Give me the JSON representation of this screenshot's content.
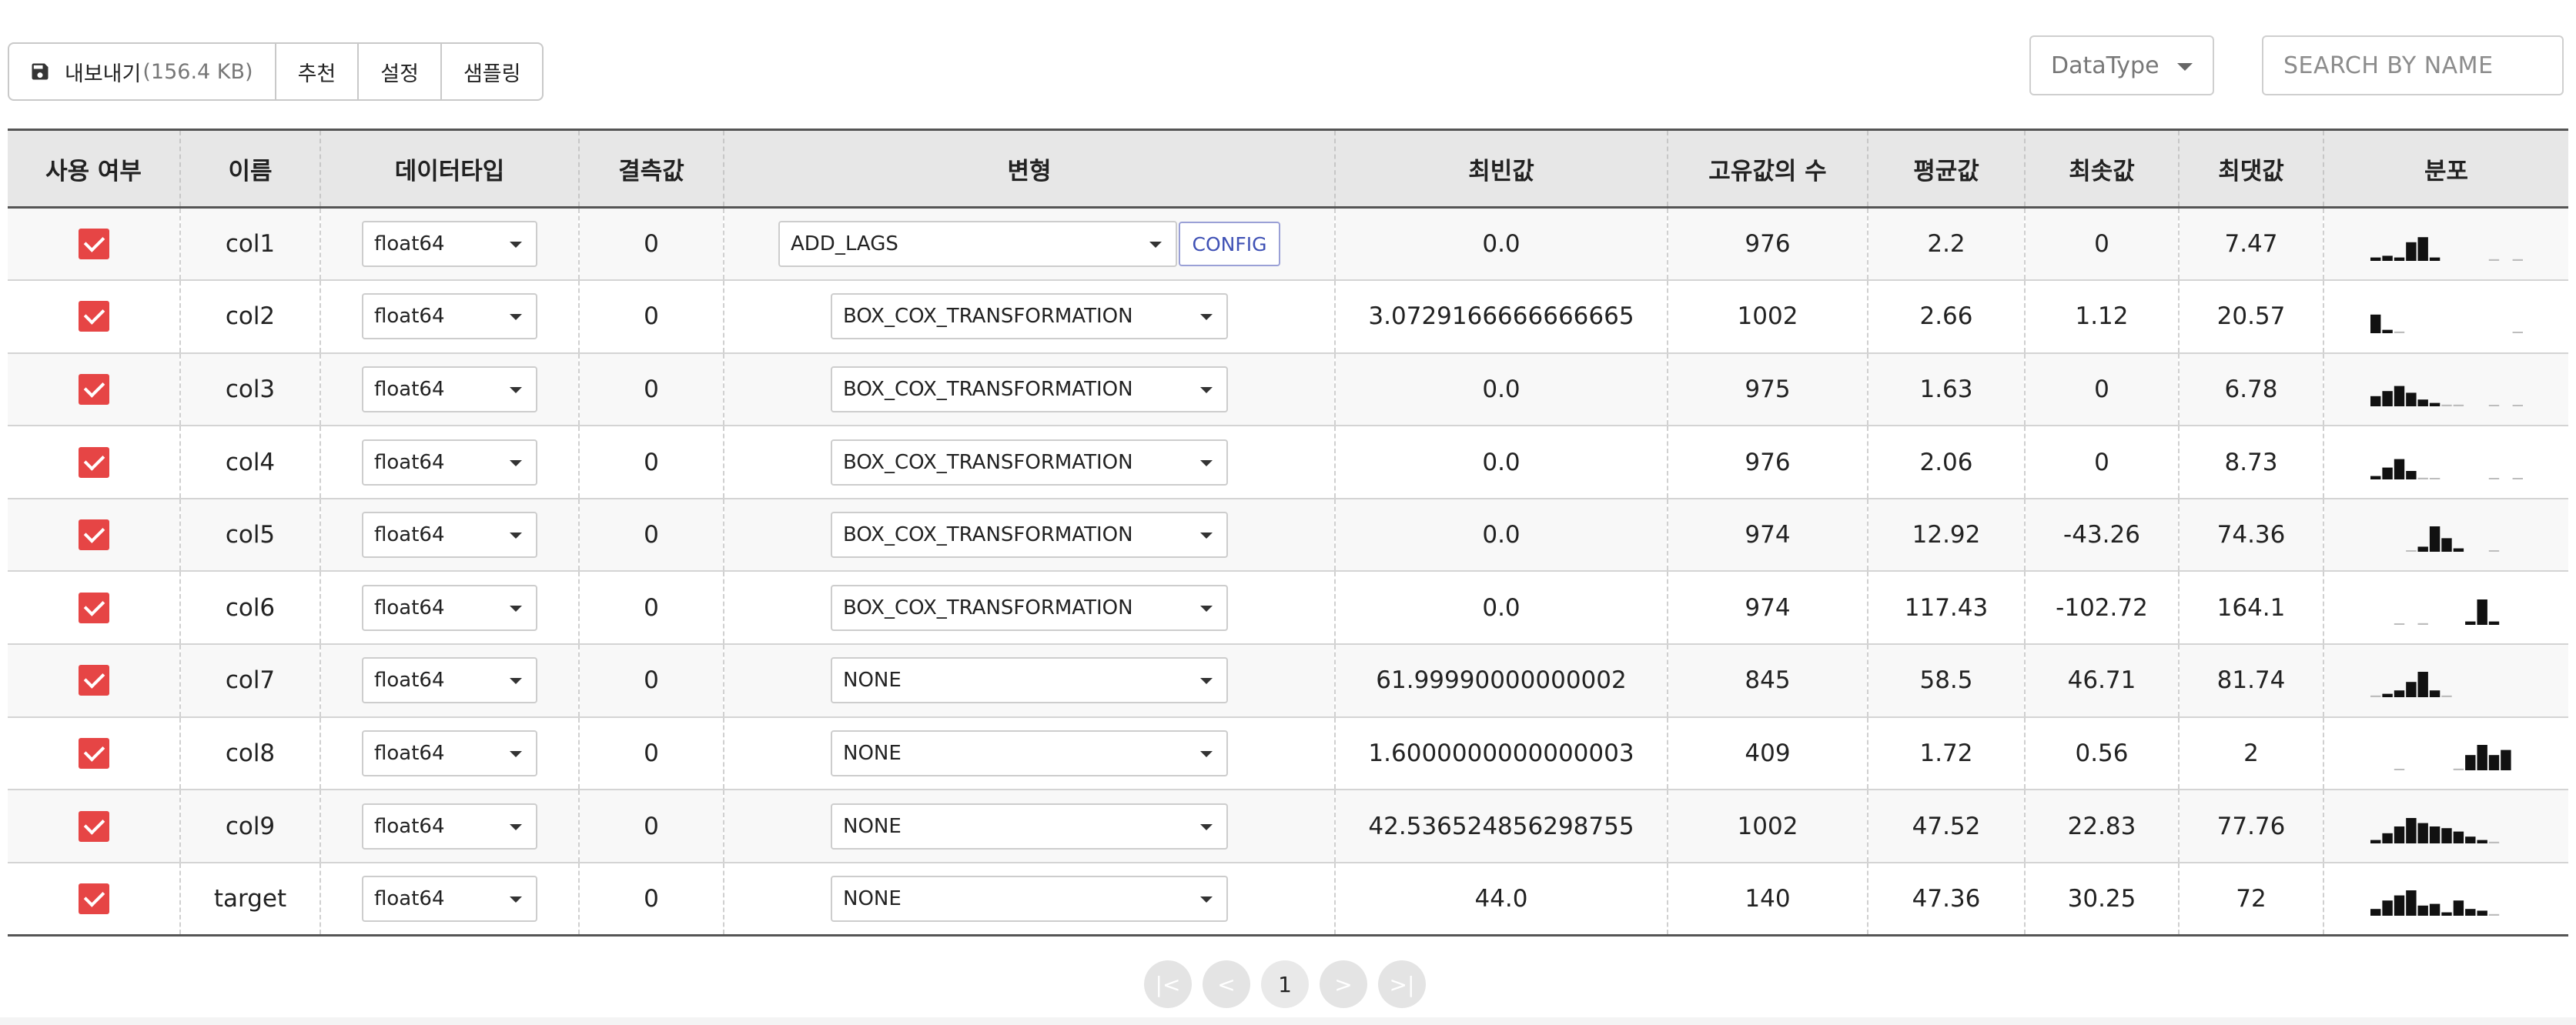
{
  "toolbar": {
    "export_label": "내보내기",
    "export_size": "(156.4 KB)",
    "recommend_label": "추천",
    "settings_label": "설정",
    "sampling_label": "샘플링",
    "datatype_filter": "DataType",
    "search_placeholder": "SEARCH BY NAME"
  },
  "table": {
    "headers": [
      "사용 여부",
      "이름",
      "데이터타입",
      "결측값",
      "변형",
      "최빈값",
      "고유값의 수",
      "평균값",
      "최솟값",
      "최댓값",
      "분포"
    ],
    "config_label": "CONFIG",
    "rows": [
      {
        "checked": true,
        "name": "col1",
        "dtype": "float64",
        "missing": "0",
        "transform": "ADD_LAGS",
        "has_config": true,
        "mode": "0.0",
        "unique": "976",
        "mean": "2.2",
        "min": "0",
        "max": "7.47",
        "hist": [
          0.1,
          0.15,
          0.1,
          0.55,
          0.7,
          0.1,
          0,
          0,
          0,
          0,
          0.05,
          0,
          0.05
        ]
      },
      {
        "checked": true,
        "name": "col2",
        "dtype": "float64",
        "missing": "0",
        "transform": "BOX_COX_TRANSFORMATION",
        "has_config": false,
        "mode": "3.0729166666666665",
        "unique": "1002",
        "mean": "2.66",
        "min": "1.12",
        "max": "20.57",
        "hist": [
          0.55,
          0.1,
          0.05,
          0,
          0,
          0,
          0,
          0,
          0,
          0,
          0,
          0,
          0.03
        ]
      },
      {
        "checked": true,
        "name": "col3",
        "dtype": "float64",
        "missing": "0",
        "transform": "BOX_COX_TRANSFORMATION",
        "has_config": false,
        "mode": "0.0",
        "unique": "975",
        "mean": "1.63",
        "min": "0",
        "max": "6.78",
        "hist": [
          0.3,
          0.45,
          0.6,
          0.4,
          0.2,
          0.1,
          0.05,
          0.05,
          0,
          0,
          0.03,
          0,
          0.03
        ]
      },
      {
        "checked": true,
        "name": "col4",
        "dtype": "float64",
        "missing": "0",
        "transform": "BOX_COX_TRANSFORMATION",
        "has_config": false,
        "mode": "0.0",
        "unique": "976",
        "mean": "2.06",
        "min": "0",
        "max": "8.73",
        "hist": [
          0.1,
          0.35,
          0.6,
          0.25,
          0.05,
          0.03,
          0,
          0,
          0,
          0,
          0.03,
          0,
          0.03
        ]
      },
      {
        "checked": true,
        "name": "col5",
        "dtype": "float64",
        "missing": "0",
        "transform": "BOX_COX_TRANSFORMATION",
        "has_config": false,
        "mode": "0.0",
        "unique": "974",
        "mean": "12.92",
        "min": "-43.26",
        "max": "74.36",
        "hist": [
          0,
          0,
          0,
          0.03,
          0.15,
          0.75,
          0.4,
          0.1,
          0,
          0,
          0.03,
          0,
          0
        ]
      },
      {
        "checked": true,
        "name": "col6",
        "dtype": "float64",
        "missing": "0",
        "transform": "BOX_COX_TRANSFORMATION",
        "has_config": false,
        "mode": "0.0",
        "unique": "974",
        "mean": "117.43",
        "min": "-102.72",
        "max": "164.1",
        "hist": [
          0,
          0,
          0.03,
          0,
          0.05,
          0,
          0,
          0,
          0.1,
          0.75,
          0.1,
          0,
          0
        ]
      },
      {
        "checked": true,
        "name": "col7",
        "dtype": "float64",
        "missing": "0",
        "transform": "NONE",
        "has_config": false,
        "mode": "61.99990000000002",
        "unique": "845",
        "mean": "58.5",
        "min": "46.71",
        "max": "81.74",
        "hist": [
          0.05,
          0.1,
          0.2,
          0.45,
          0.75,
          0.2,
          0.05,
          0,
          0,
          0,
          0,
          0,
          0
        ]
      },
      {
        "checked": true,
        "name": "col8",
        "dtype": "float64",
        "missing": "0",
        "transform": "NONE",
        "has_config": false,
        "mode": "1.6000000000000003",
        "unique": "409",
        "mean": "1.72",
        "min": "0.56",
        "max": "2",
        "hist": [
          0,
          0,
          0.03,
          0,
          0,
          0,
          0,
          0.05,
          0.45,
          0.75,
          0.45,
          0.6,
          0
        ]
      },
      {
        "checked": true,
        "name": "col9",
        "dtype": "float64",
        "missing": "0",
        "transform": "NONE",
        "has_config": false,
        "mode": "42.536524856298755",
        "unique": "1002",
        "mean": "47.52",
        "min": "22.83",
        "max": "77.76",
        "hist": [
          0.1,
          0.3,
          0.5,
          0.75,
          0.6,
          0.5,
          0.45,
          0.35,
          0.2,
          0.1,
          0.05,
          0,
          0
        ]
      },
      {
        "checked": true,
        "name": "target",
        "dtype": "float64",
        "missing": "0",
        "transform": "NONE",
        "has_config": false,
        "mode": "44.0",
        "unique": "140",
        "mean": "47.36",
        "min": "30.25",
        "max": "72",
        "hist": [
          0.2,
          0.45,
          0.6,
          0.75,
          0.3,
          0.35,
          0.1,
          0.45,
          0.2,
          0.15,
          0.05,
          0,
          0
        ]
      }
    ]
  },
  "pagination": {
    "first": "|<",
    "prev": "<",
    "current": "1",
    "next": ">",
    "last": ">|"
  },
  "colors": {
    "checkbox": "#e64545",
    "config_text": "#3f51b5",
    "header_bg": "#e7e7e7"
  }
}
